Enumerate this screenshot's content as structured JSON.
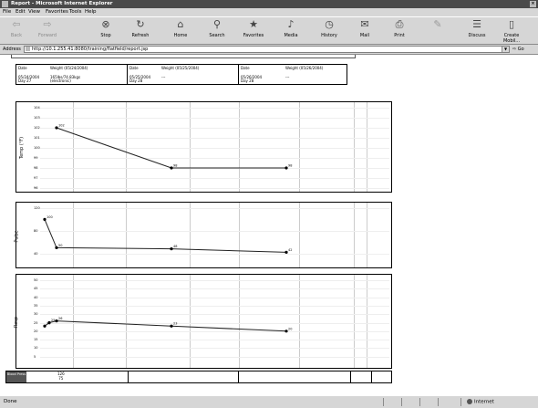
{
  "window": {
    "title": "Report - Microsoft Internet Explorer",
    "controls": "×"
  },
  "menu": [
    "File",
    "Edit",
    "View",
    "Favorites",
    "Tools",
    "Help"
  ],
  "toolbar": [
    {
      "label": "Back",
      "icon": "⇦",
      "disabled": true
    },
    {
      "label": "Forward",
      "icon": "⇨",
      "disabled": true
    },
    {
      "label": "Stop",
      "icon": "⊗",
      "disabled": false
    },
    {
      "label": "Refresh",
      "icon": "↻",
      "disabled": false
    },
    {
      "label": "Home",
      "icon": "⌂",
      "disabled": false
    },
    {
      "label": "Search",
      "icon": "⚲",
      "disabled": false
    },
    {
      "label": "Favorites",
      "icon": "★",
      "disabled": false
    },
    {
      "label": "Media",
      "icon": "♪",
      "disabled": false
    },
    {
      "label": "History",
      "icon": "◷",
      "disabled": false
    },
    {
      "label": "Mail",
      "icon": "✉",
      "disabled": false
    },
    {
      "label": "Print",
      "icon": "⎙",
      "disabled": false
    },
    {
      "label": "",
      "icon": "✎",
      "disabled": true
    },
    {
      "label": "Discuss",
      "icon": "☰",
      "disabled": false
    },
    {
      "label": "Create Mobil...",
      "icon": "▯",
      "disabled": false
    }
  ],
  "address": {
    "label": "Address",
    "url": "http://10.1.255.41:8080/training/flatfield/report.jsp",
    "go_label": "Go"
  },
  "weights": [
    {
      "date_label": "Date",
      "weight_label": "Weight (05/24/2004)",
      "date": "05/24/2004",
      "day": "Day 27",
      "value": "165lbs/74.83kgs",
      "note": "(electronic)"
    },
    {
      "date_label": "Date",
      "weight_label": "Weight (05/25/2004)",
      "date": "05/25/2004",
      "day": "Day 28",
      "value": "---",
      "note": ""
    },
    {
      "date_label": "Date",
      "weight_label": "Weight (05/26/2004)",
      "date": "05/26/2004",
      "day": "Day 28",
      "value": "---",
      "note": ""
    }
  ],
  "chart_data": [
    {
      "type": "line",
      "ylabel": "Temp (°F)",
      "ylim": [
        96,
        104
      ],
      "yticks": [
        "104",
        "103",
        "102",
        "101",
        "100",
        "99",
        "98",
        "97",
        "96"
      ],
      "series": [
        {
          "values": [
            102,
            98,
            98
          ]
        }
      ],
      "labels": [
        "102",
        "98",
        "98"
      ]
    },
    {
      "type": "line",
      "ylabel": "Pulse",
      "ylim": [
        20,
        120
      ],
      "yticks": [
        "120",
        "80",
        "40"
      ],
      "series": [
        {
          "values": [
            100,
            50,
            48,
            42
          ]
        }
      ],
      "labels": [
        "100",
        "50",
        "48",
        "42"
      ]
    },
    {
      "type": "line",
      "ylabel": "Resp",
      "ylim": [
        0,
        50
      ],
      "yticks": [
        "50",
        "45",
        "40",
        "35",
        "30",
        "25",
        "20",
        "15",
        "10",
        "5"
      ],
      "series": [
        {
          "values": [
            23,
            25,
            26,
            23,
            20
          ]
        }
      ],
      "labels": [
        "23",
        "25",
        "26",
        "23",
        "20"
      ]
    }
  ],
  "blood_pressure": {
    "label": "Blood Press",
    "value": "126\n75"
  },
  "status": {
    "text": "Done",
    "zone": "Internet"
  }
}
